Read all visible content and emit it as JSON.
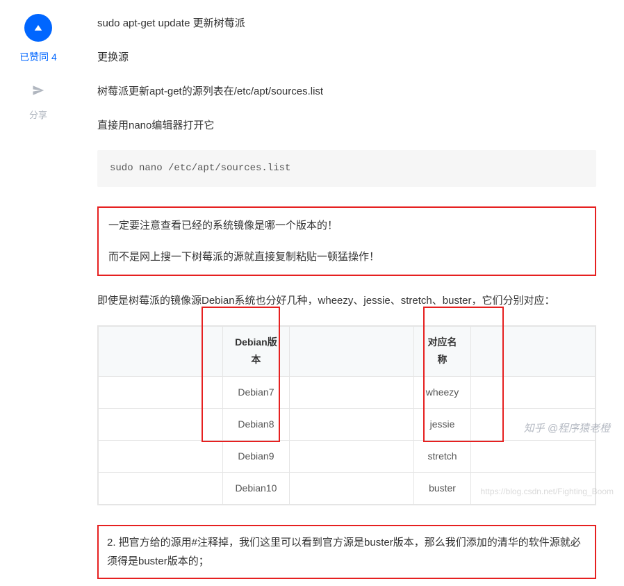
{
  "sidebar": {
    "upvote_prefix": "已赞同",
    "upvote_count": "4",
    "share_label": "分享"
  },
  "content": {
    "p1": "sudo apt-get update 更新树莓派",
    "p2": "更换源",
    "p3": "树莓派更新apt-get的源列表在/etc/apt/sources.list",
    "p4": "直接用nano编辑器打开它",
    "code1": "sudo nano /etc/apt/sources.list",
    "warn1": "一定要注意查看已经的系统镜像是哪一个版本的！",
    "warn2": "而不是网上搜一下树莓派的源就直接复制粘贴一顿猛操作！",
    "p5": "即使是树莓派的镜像源Debian系统也分好几种，wheezy、jessie、stretch、buster，它们分别对应：",
    "note2": "2. 把官方给的源用#注释掉，我们这里可以看到官方源是buster版本，那么我们添加的清华的软件源就必须得是buster版本的；"
  },
  "table": {
    "header_left": "Debian版本",
    "header_right": "对应名称",
    "rows": [
      {
        "left": "Debian7",
        "right": "wheezy"
      },
      {
        "left": "Debian8",
        "right": "jessie"
      },
      {
        "left": "Debian9",
        "right": "stretch"
      },
      {
        "left": "Debian10",
        "right": "buster"
      }
    ]
  },
  "watermark": {
    "zhihu": "知乎 @程序猿老橙",
    "csdn": "https://blog.csdn.net/Fighting_Boom"
  },
  "chart_data": {
    "type": "table",
    "title": "Debian版本 对应名称",
    "columns": [
      "Debian版本",
      "对应名称"
    ],
    "rows": [
      [
        "Debian7",
        "wheezy"
      ],
      [
        "Debian8",
        "jessie"
      ],
      [
        "Debian9",
        "stretch"
      ],
      [
        "Debian10",
        "buster"
      ]
    ]
  }
}
